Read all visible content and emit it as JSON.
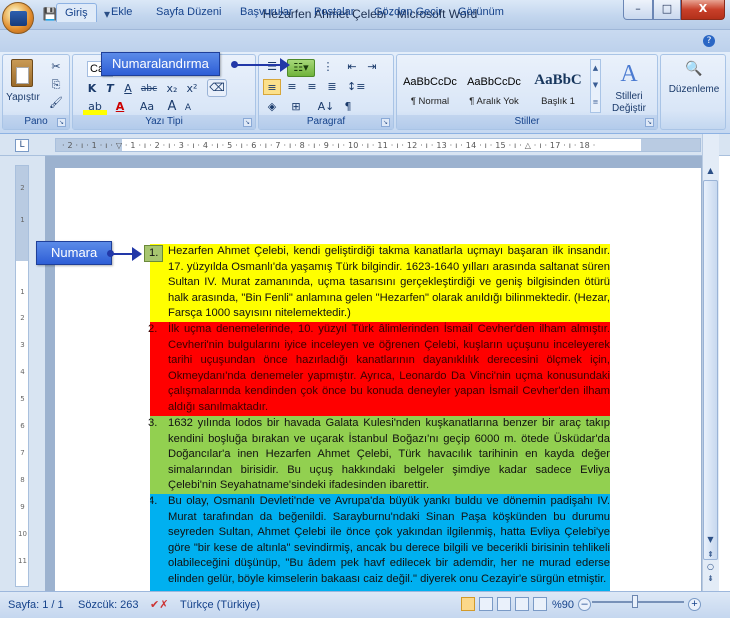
{
  "window": {
    "title": "Hezarfen Ahmet Çelebi - Microsoft Word",
    "minimize": "–",
    "maximize": "□",
    "close": "X"
  },
  "qat": {
    "save": "💾",
    "undo": "↶",
    "redo": "↷",
    "more": "▾"
  },
  "tabs": [
    "Giriş",
    "Ekle",
    "Sayfa Düzeni",
    "Başvurular",
    "Postalar",
    "Gözden Geçir",
    "Görünüm"
  ],
  "ribbon": {
    "pano": {
      "paste_label": "Yapıştır",
      "group_label": "Pano"
    },
    "yazi": {
      "font_name": "Ca",
      "bold": "K",
      "italic": "T",
      "underline": "A",
      "strike": "abc",
      "sub": "x₂",
      "sup": "x²",
      "grow": "A",
      "shrink": "A",
      "case": "Aa",
      "group_label": "Yazı Tipi"
    },
    "paragraf": {
      "group_label": "Paragraf",
      "sort": "A↓",
      "pilcrow": "¶"
    },
    "stiller": {
      "group_label": "Stiller",
      "items": [
        {
          "sample": "AaBbCcDc",
          "name": "¶ Normal"
        },
        {
          "sample": "AaBbCcDc",
          "name": "¶ Aralık Yok"
        },
        {
          "sample": "AaBbC",
          "name": "Başlık 1"
        }
      ],
      "change_label": "Stilleri Değiştir",
      "change_arrow": "▾"
    },
    "duzenleme": {
      "label": "Düzenleme"
    }
  },
  "callouts": {
    "top": "Numaralandırma",
    "left": "Numara"
  },
  "ruler": {
    "h_numbers": "· 2 · ı · 1 · ı · ▽ · 1 · ı · 2 · ı · 3 · ı · 4 · ı · 5 · ı · 6 · ı · 7 · ı · 8 · ı · 9 · ı · 10 · ı · 11 · ı · 12 · ı · 13 · ı · 14 · ı · 15 · ı · △ · ı · 17 · ı · 18 ·",
    "v_numbers": [
      "2",
      "1",
      "1",
      "2",
      "3",
      "4",
      "5",
      "6",
      "7",
      "8",
      "9",
      "10",
      "11",
      "12"
    ]
  },
  "paragraphs": [
    {
      "num": "1.",
      "text": "Hezarfen Ahmet Çelebi, kendi geliştirdiği takma kanatlarla uçmayı başaran ilk insandır. 17. yüzyılda Osmanlı'da yaşamış Türk bilgindir. 1623-1640 yılları arasında saltanat süren Sultan IV. Murat zamanında, uçma tasarısını gerçekleştirdiği ve geniş bilgisinden ötürü halk arasında, \"Bin Fenli\" anlamına gelen \"Hezarfen\" olarak anıldığı bilinmektedir. (Hezar, Farsça 1000 sayısını nitelemektedir.)"
    },
    {
      "num": "2.",
      "text": "İlk uçma denemelerinde, 10. yüzyıl Türk âlimlerinden İsmail Cevher'den ilham almıştır. Cevheri'nin bulgularını iyice inceleyen ve öğrenen Çelebi, kuşların uçuşunu inceleyerek tarihi uçuşundan önce hazırladığı kanatlarının dayanıklılık derecesini ölçmek için, Okmeydanı'nda denemeler yapmıştır. Ayrıca, Leonardo Da Vinci'nin uçma konusundaki çalışmalarında kendinden çok önce bu konuda deneyler yapan İsmail Cevher'den ilham aldığı sanılmaktadır."
    },
    {
      "num": "3.",
      "text": "1632 yılında lodos bir havada Galata Kulesi'nden kuşkanatlarına benzer bir araç takıp kendini boşluğa bırakan ve uçarak İstanbul Boğazı'nı geçip 6000 m. ötede Üsküdar'da Doğancılar'a inen Hezarfen Ahmet Çelebi, Türk havacılık tarihinin en kayda değer simalarından birisidir. Bu uçuş hakkındaki belgeler şimdiye kadar sadece Evliya Çelebi'nin Seyahatname'sindeki ifadesinden ibarettir."
    },
    {
      "num": "4.",
      "text": "Bu olay, Osmanlı Devleti'nde ve Avrupa'da büyük yankı buldu ve dönemin padişahı IV. Murat tarafından da beğenildi. Sarayburnu'ndaki Sinan Paşa köşkünden bu durumu seyreden Sultan, Ahmet Çelebi ile önce çok yakından ilgilenmiş, hatta Evliya Çelebi'ye göre \"bir kese de altınla\" sevindirmiş, ancak bu derece bilgili ve becerikli birisinin tehlikeli olabileceğini düşünüp, \"Bu âdem pek havf edilecek bir ademdir, her ne murad ederse elinden gelür, böyle kimselerin bakaası caiz değil.\" diyerek onu Cezayir'e sürgün etmiştir."
    }
  ],
  "status": {
    "page": "Sayfa: 1 / 1",
    "words": "Sözcük: 263",
    "language": "Türkçe (Türkiye)",
    "zoom": "%90",
    "zoom_minus": "–",
    "zoom_plus": "+"
  },
  "colors": {
    "p1": "#ffff00",
    "p2": "#ff0000",
    "p3": "#92d050",
    "p4": "#00b0f0",
    "callout": "#2e5ed6"
  }
}
